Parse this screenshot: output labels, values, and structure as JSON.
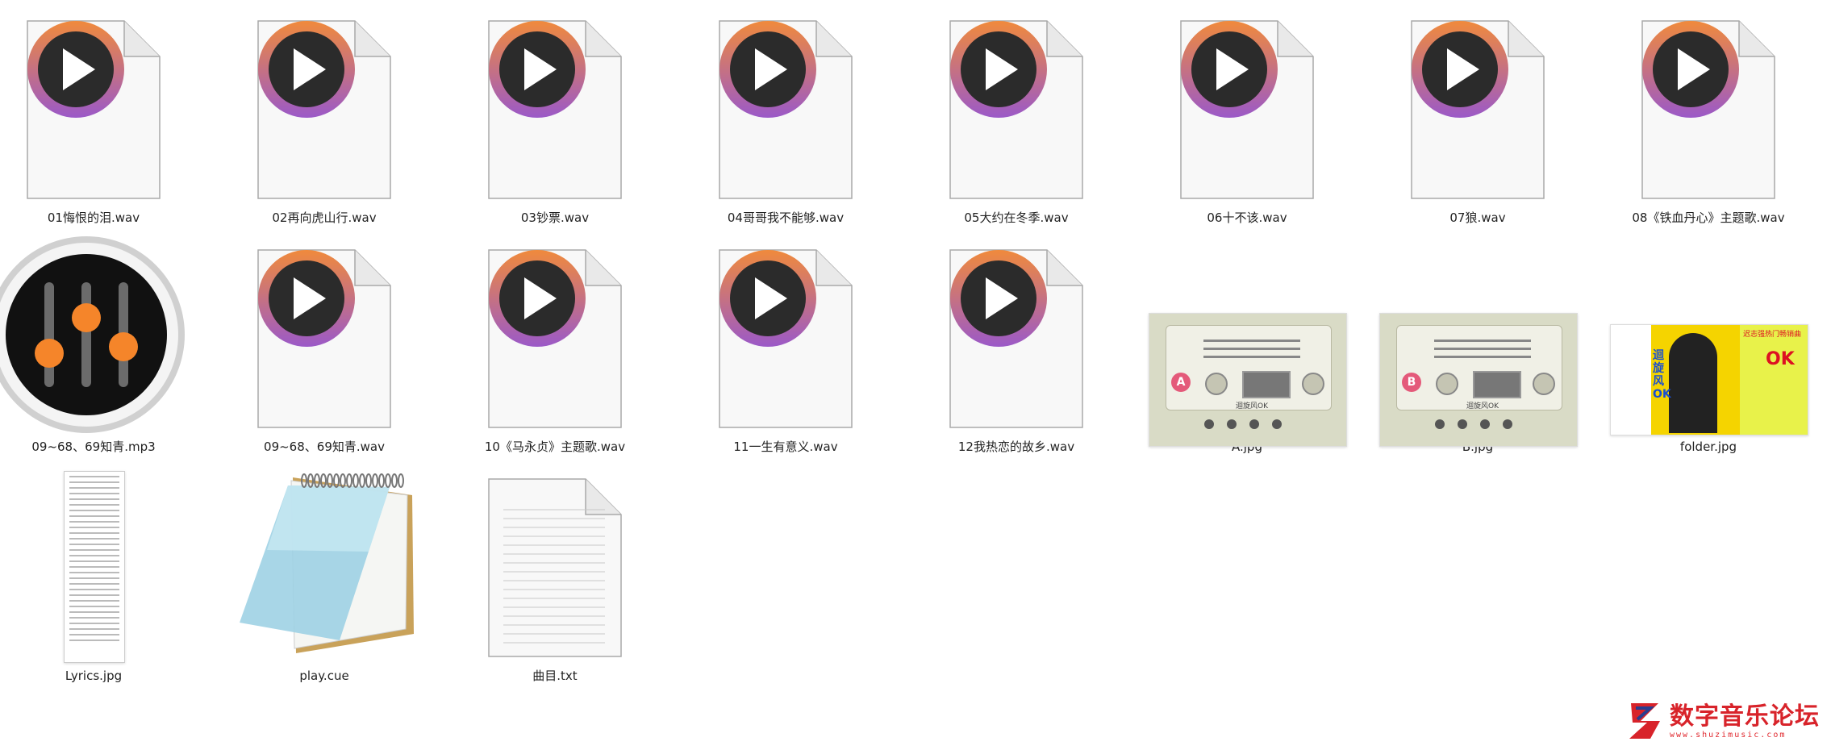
{
  "files": [
    {
      "name": "01悔恨的泪.wav",
      "type": "audio"
    },
    {
      "name": "02再向虎山行.wav",
      "type": "audio"
    },
    {
      "name": "03钞票.wav",
      "type": "audio"
    },
    {
      "name": "04哥哥我不能够.wav",
      "type": "audio"
    },
    {
      "name": "05大约在冬季.wav",
      "type": "audio"
    },
    {
      "name": "06十不该.wav",
      "type": "audio"
    },
    {
      "name": "07狼.wav",
      "type": "audio"
    },
    {
      "name": "08《铁血丹心》主题歌.wav",
      "type": "audio"
    },
    {
      "name": "09~68、69知青.mp3",
      "type": "mp3"
    },
    {
      "name": "09~68、69知青.wav",
      "type": "audio"
    },
    {
      "name": "10《马永贞》主题歌.wav",
      "type": "audio"
    },
    {
      "name": "11一生有意义.wav",
      "type": "audio"
    },
    {
      "name": "12我热恋的故乡.wav",
      "type": "audio"
    },
    {
      "name": "A.jpg",
      "type": "cassette",
      "side": "A"
    },
    {
      "name": "B.jpg",
      "type": "cassette",
      "side": "B"
    },
    {
      "name": "folder.jpg",
      "type": "folder-art"
    },
    {
      "name": "Lyrics.jpg",
      "type": "lyrics"
    },
    {
      "name": "play.cue",
      "type": "cue"
    },
    {
      "name": "曲目.txt",
      "type": "txt"
    }
  ],
  "folder_art": {
    "title": "迟志强热门畅销曲",
    "cover_text": "迴旋风OK",
    "ok": "OK"
  },
  "cassette_label": "迴旋风OK",
  "watermark": {
    "title": "数字音乐论坛",
    "url": "www.shuzimusic.com"
  },
  "colors": {
    "play_ring_top": "#f08a3c",
    "play_ring_bottom": "#9b59c8",
    "play_disc": "#2b2b2b",
    "mixer_knob": "#f5852a",
    "watermark": "#d8232a"
  }
}
